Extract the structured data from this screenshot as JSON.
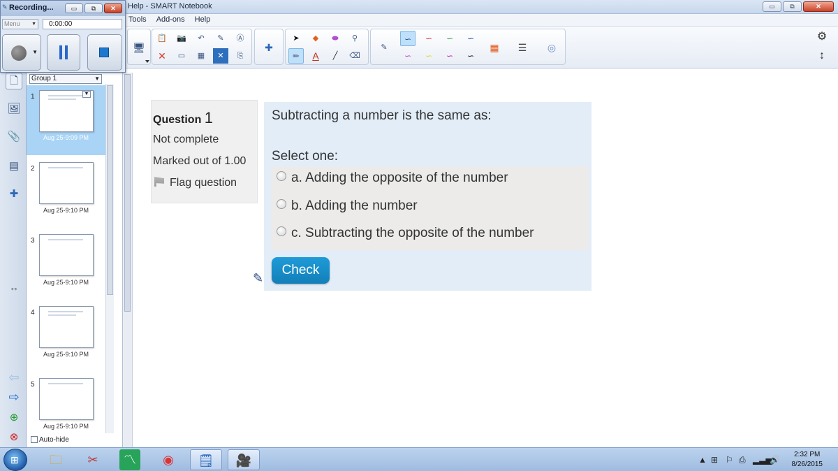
{
  "window": {
    "title": "Help - SMART Notebook",
    "buttons": [
      "▭",
      "⧉",
      "✕"
    ]
  },
  "menubar": {
    "items": [
      "Tools",
      "Add-ons",
      "Help"
    ]
  },
  "recorder": {
    "title": "Recording...",
    "menu_label": "Menu",
    "timer": "0:00:00",
    "buttons": [
      "▭",
      "⧉",
      "✕"
    ]
  },
  "sorter": {
    "group": "Group 1",
    "pages": [
      {
        "num": "1",
        "date": "Aug 25-9:09 PM"
      },
      {
        "num": "2",
        "date": "Aug 25-9:10 PM"
      },
      {
        "num": "3",
        "date": "Aug 25-9:10 PM"
      },
      {
        "num": "4",
        "date": "Aug 25-9:10 PM"
      },
      {
        "num": "5",
        "date": "Aug 25-9:10 PM"
      }
    ],
    "autohide": "Auto-hide"
  },
  "quiz": {
    "question_label": "Question",
    "question_number": "1",
    "state": "Not complete",
    "grade": "Marked out of 1.00",
    "flag": "Flag question",
    "text": "Subtracting a number is the same as:",
    "prompt": "Select one:",
    "options": [
      "a. Adding the opposite of the number",
      "b. Adding the number",
      "c. Subtracting the opposite of the number"
    ],
    "check": "Check"
  },
  "taskbar": {
    "time": "2:32 PM",
    "date": "8/26/2015"
  },
  "colors": {
    "check_button": "#1a8dc9",
    "question_bg": "#e2edf8",
    "info_bg": "#f0f0f0"
  }
}
